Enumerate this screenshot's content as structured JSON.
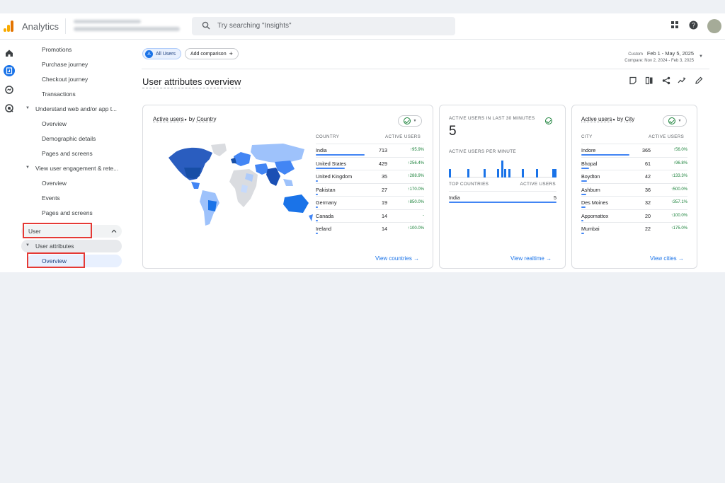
{
  "header": {
    "app_title": "Analytics",
    "search_placeholder": "Try searching \"Insights\""
  },
  "sidebar": {
    "items": [
      {
        "label": "Promotions"
      },
      {
        "label": "Purchase journey"
      },
      {
        "label": "Checkout journey"
      },
      {
        "label": "Transactions"
      },
      {
        "label": "Understand web and/or app t..."
      },
      {
        "label": "Overview"
      },
      {
        "label": "Demographic details"
      },
      {
        "label": "Pages and screens"
      },
      {
        "label": "View user engagement & rete..."
      },
      {
        "label": "Overview"
      },
      {
        "label": "Events"
      },
      {
        "label": "Pages and screens"
      }
    ],
    "section_user": "User",
    "user_attributes": "User attributes",
    "overview_active": "Overview"
  },
  "toolbar": {
    "chip_all_users": "All Users",
    "chip_all_users_letter": "A",
    "add_comparison": "Add comparison",
    "date_custom": "Custom",
    "date_range": "Feb 1 - May 5, 2025",
    "compare_range": "Compare: Nov 2, 2024 - Feb 3, 2025"
  },
  "page_title": "User attributes overview",
  "country_card": {
    "title_metric": "Active users",
    "title_by": "by",
    "title_dimension": "Country",
    "col_country": "COUNTRY",
    "col_active": "ACTIVE USERS",
    "rows": [
      {
        "name": "India",
        "value": "713",
        "change": "↑95.9%",
        "share": 1.0
      },
      {
        "name": "United States",
        "value": "429",
        "change": "↑256.4%",
        "share": 0.6
      },
      {
        "name": "United Kingdom",
        "value": "35",
        "change": "↑288.9%",
        "share": 0.05
      },
      {
        "name": "Pakistan",
        "value": "27",
        "change": "↑170.0%",
        "share": 0.04
      },
      {
        "name": "Germany",
        "value": "19",
        "change": "↑850.0%",
        "share": 0.03
      },
      {
        "name": "Canada",
        "value": "14",
        "change": "-",
        "share": 0.02
      },
      {
        "name": "Ireland",
        "value": "14",
        "change": "↑100.0%",
        "share": 0.02
      }
    ],
    "link": "View countries"
  },
  "realtime_card": {
    "title": "ACTIVE USERS IN LAST 30 MINUTES",
    "big_value": "5",
    "per_minute_label": "ACTIVE USERS PER MINUTE",
    "per_minute": [
      1,
      0,
      0,
      0,
      0,
      0,
      0,
      0,
      1,
      0,
      0,
      0,
      0,
      0,
      0,
      1,
      0,
      0,
      0,
      0,
      0,
      1,
      0,
      2,
      1,
      0,
      1,
      0,
      0,
      0,
      0,
      0,
      1,
      0,
      0,
      0,
      0,
      0,
      1,
      0,
      0,
      0,
      0,
      0,
      0,
      1,
      1
    ],
    "col_top_countries": "TOP COUNTRIES",
    "col_active": "ACTIVE USERS",
    "rows": [
      {
        "name": "India",
        "value": "5"
      }
    ],
    "link": "View realtime"
  },
  "city_card": {
    "title_metric": "Active users",
    "title_by": "by",
    "title_dimension": "City",
    "col_city": "CITY",
    "col_active": "ACTIVE USERS",
    "rows": [
      {
        "name": "Indore",
        "value": "365",
        "change": "↑56.0%",
        "share": 1.0
      },
      {
        "name": "Bhopal",
        "value": "61",
        "change": "↑96.8%",
        "share": 0.17
      },
      {
        "name": "Boydton",
        "value": "42",
        "change": "↑133.3%",
        "share": 0.12
      },
      {
        "name": "Ashburn",
        "value": "36",
        "change": "↑500.0%",
        "share": 0.1
      },
      {
        "name": "Des Moines",
        "value": "32",
        "change": "↑357.1%",
        "share": 0.09
      },
      {
        "name": "Appomattox",
        "value": "20",
        "change": "↑100.0%",
        "share": 0.05
      },
      {
        "name": "Mumbai",
        "value": "22",
        "change": "↑175.0%",
        "share": 0.06
      }
    ],
    "link": "View cities"
  },
  "colors": {
    "accent": "#1a73e8",
    "positive": "#188038",
    "highlight_box": "#e53935"
  }
}
